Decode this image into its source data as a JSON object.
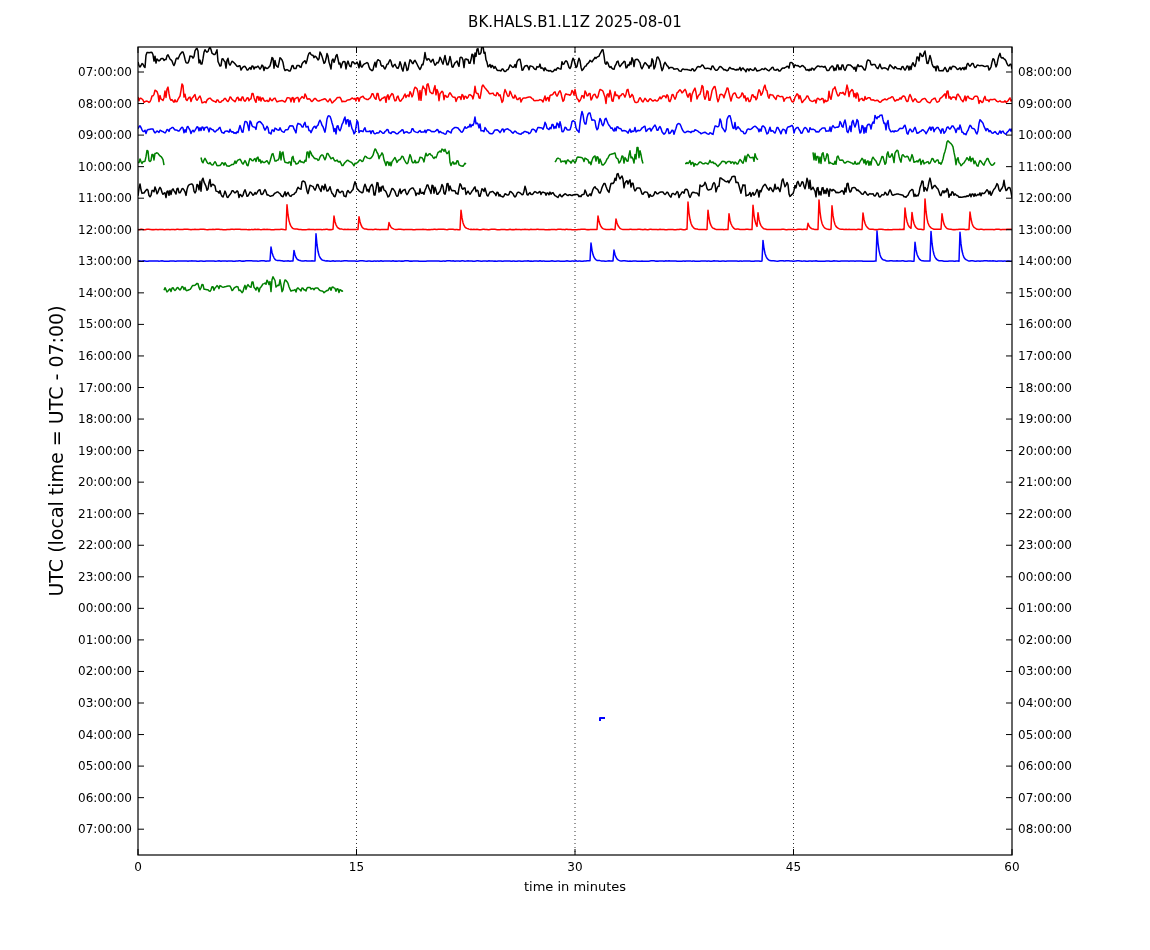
{
  "title": "BK.HALS.B1.L1Z 2025-08-01",
  "ylabel": "UTC (local time = UTC - 07:00)",
  "xlabel": "time in minutes",
  "xticks": [
    "0",
    "15",
    "30",
    "45",
    "60"
  ],
  "left_ticks": [
    "07:00:00",
    "08:00:00",
    "09:00:00",
    "10:00:00",
    "11:00:00",
    "12:00:00",
    "13:00:00",
    "14:00:00",
    "15:00:00",
    "16:00:00",
    "17:00:00",
    "18:00:00",
    "19:00:00",
    "20:00:00",
    "21:00:00",
    "22:00:00",
    "23:00:00",
    "00:00:00",
    "01:00:00",
    "02:00:00",
    "03:00:00",
    "04:00:00",
    "05:00:00",
    "06:00:00",
    "07:00:00"
  ],
  "right_ticks": [
    "08:00:00",
    "09:00:00",
    "10:00:00",
    "11:00:00",
    "12:00:00",
    "13:00:00",
    "14:00:00",
    "15:00:00",
    "16:00:00",
    "17:00:00",
    "18:00:00",
    "19:00:00",
    "20:00:00",
    "21:00:00",
    "22:00:00",
    "23:00:00",
    "00:00:00",
    "01:00:00",
    "02:00:00",
    "03:00:00",
    "04:00:00",
    "05:00:00",
    "06:00:00",
    "07:00:00",
    "08:00:00"
  ],
  "traces": [
    {
      "kind": "busy",
      "color": "#000000"
    },
    {
      "kind": "busy",
      "color": "#ff0000"
    },
    {
      "kind": "busy",
      "color": "#0000ff"
    },
    {
      "kind": "gappy",
      "color": "#008000"
    },
    {
      "kind": "busy",
      "color": "#000000"
    },
    {
      "kind": "quiet",
      "color": "#ff0000"
    },
    {
      "kind": "quiet",
      "color": "#0000ff"
    },
    {
      "kind": "partial",
      "color": "#008000"
    },
    {
      "kind": "blip",
      "color": "#0000ff"
    }
  ]
}
